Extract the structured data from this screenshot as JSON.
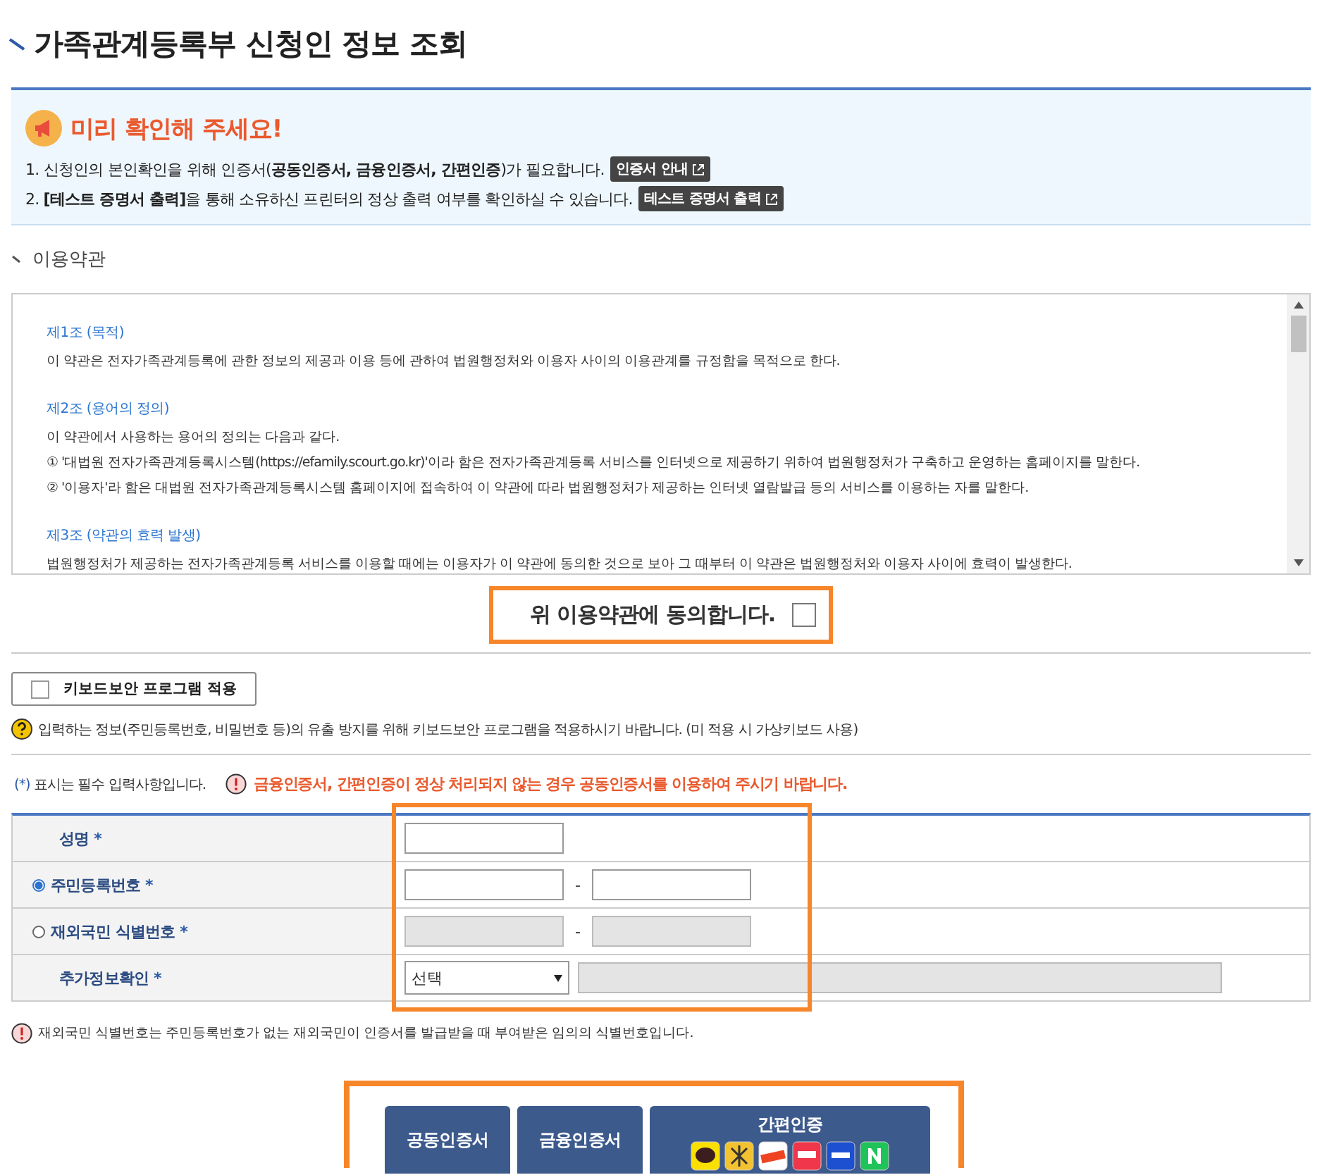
{
  "title": "가족관계등록부 신청인 정보 조회",
  "notice": {
    "heading": "미리 확인해 주세요!",
    "lines": [
      {
        "text": "1. 신청인의 본인확인을 위해 인증서(**공동인증서, 금융인증서, 간편인증**)가 필요합니다.",
        "link": "인증서 안내"
      },
      {
        "text": "2. **[테스트 증명서 출력]**을 통해 소유하신 프린터의 정상 출력 여부를 확인하실 수 있습니다.",
        "link": "테스트 증명서 출력"
      }
    ]
  },
  "terms": {
    "heading": "이용약관",
    "articles": [
      {
        "title": "제1조 (목적)",
        "lines": [
          "이 약관은 전자가족관계등록에 관한 정보의 제공과 이용 등에 관하여 법원행정처와 이용자 사이의 이용관계를 규정함을 목적으로 한다."
        ]
      },
      {
        "title": "제2조 (용어의 정의)",
        "lines": [
          "이 약관에서 사용하는 용어의 정의는 다음과 같다.",
          "① '대법원 전자가족관계등록시스템(https://efamily.scourt.go.kr)'이라 함은 전자가족관계등록 서비스를 인터넷으로 제공하기 위하여 법원행정처가 구축하고 운영하는 홈페이지를 말한다.",
          "② '이용자'라 함은 대법원 전자가족관계등록시스템 홈페이지에 접속하여 이 약관에 따라 법원행정처가 제공하는 인터넷 열람발급 등의 서비스를 이용하는 자를 말한다."
        ]
      },
      {
        "title": "제3조 (약관의 효력 발생)",
        "lines": [
          "법원행정처가 제공하는 전자가족관계등록 서비스를 이용할 때에는 이용자가 이 약관에 동의한 것으로 보아 그 때부터 이 약관은 법원행정처와 이용자 사이에 효력이 발생한다."
        ]
      }
    ]
  },
  "agree": {
    "label": "위 이용약관에 동의합니다.",
    "checked": false,
    "highlighted": true
  },
  "keyboard": {
    "label": "키보드보안 프로그램 적용",
    "checked": false
  },
  "keyboard_help": "입력하는 정보(주민등록번호, 비밀번호 등)의 유출 방지를 위해 키보드보안 프로그램을 적용하시기 바랍니다. (미 적용 시 가상키보드 사용)",
  "required_note": {
    "mark": "(*)",
    "text": "표시는 필수 입력사항입니다."
  },
  "warning": "금융인증서, 간편인증이 정상 처리되지 않는 경우 공동인증서를 이용하여 주시기 바랍니다.",
  "form": {
    "highlighted": true,
    "rows": [
      {
        "kind": "text",
        "label": "성명",
        "mark": "*",
        "disabled": false
      },
      {
        "kind": "pair",
        "label": "주민등록번호",
        "mark": "*",
        "radio": true,
        "selected": true,
        "separator": "-",
        "disabled": false
      },
      {
        "kind": "pair",
        "label": "재외국민 식별번호",
        "mark": "*",
        "radio": true,
        "selected": false,
        "separator": "-",
        "disabled": true
      },
      {
        "kind": "select",
        "label": "추가정보확인",
        "mark": "*",
        "option": "선택",
        "disabled": true
      }
    ]
  },
  "foreign_note": "재외국민 식별번호는 주민등록번호가 없는 재외국민이 인증서를 발급받을 때 부여받은 임의의 식별번호입니다.",
  "buttons": {
    "highlighted": true,
    "items": [
      {
        "kind": "plain",
        "label": "공동인증서"
      },
      {
        "kind": "plain",
        "label": "금융인증서"
      },
      {
        "kind": "apps",
        "label": "간편인증"
      }
    ]
  }
}
